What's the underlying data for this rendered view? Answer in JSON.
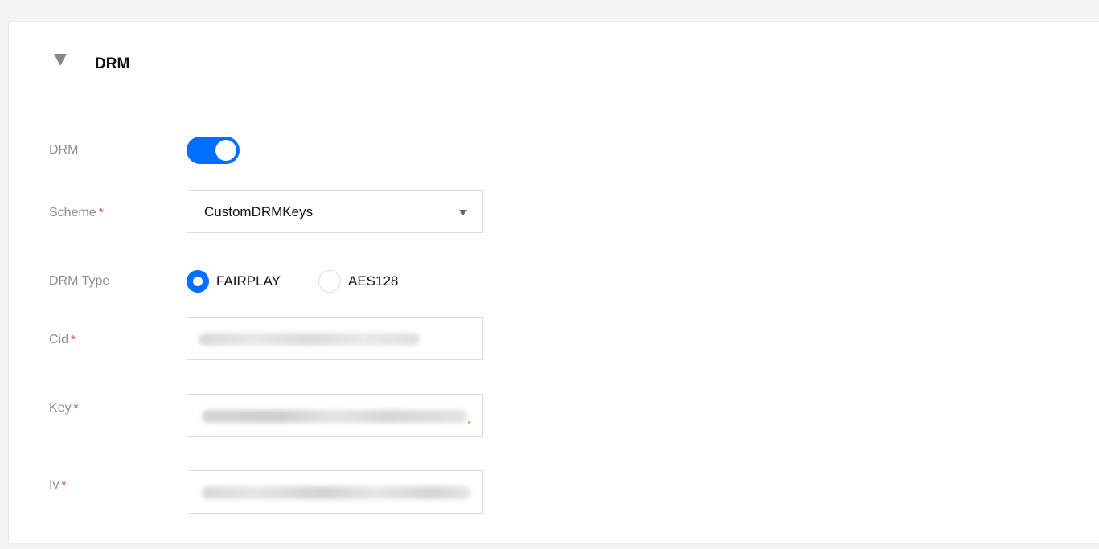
{
  "section": {
    "title": "DRM",
    "collapse_icon": "caret-down-icon"
  },
  "form": {
    "drm": {
      "label": "DRM",
      "enabled": true
    },
    "scheme": {
      "label": "Scheme",
      "required_mark": "*",
      "value": "CustomDRMKeys"
    },
    "drm_type": {
      "label": "DRM Type",
      "options": [
        "FAIRPLAY",
        "AES128"
      ],
      "selected": "FAIRPLAY"
    },
    "cid": {
      "label": "Cid",
      "required_mark": "*"
    },
    "key": {
      "label": "Key",
      "required_mark": "*"
    },
    "iv": {
      "label": "Iv",
      "required_mark": "*"
    }
  },
  "colors": {
    "accent": "#006eff",
    "required": "#e54545",
    "label": "#8c8f94",
    "border": "#d9dce1"
  }
}
